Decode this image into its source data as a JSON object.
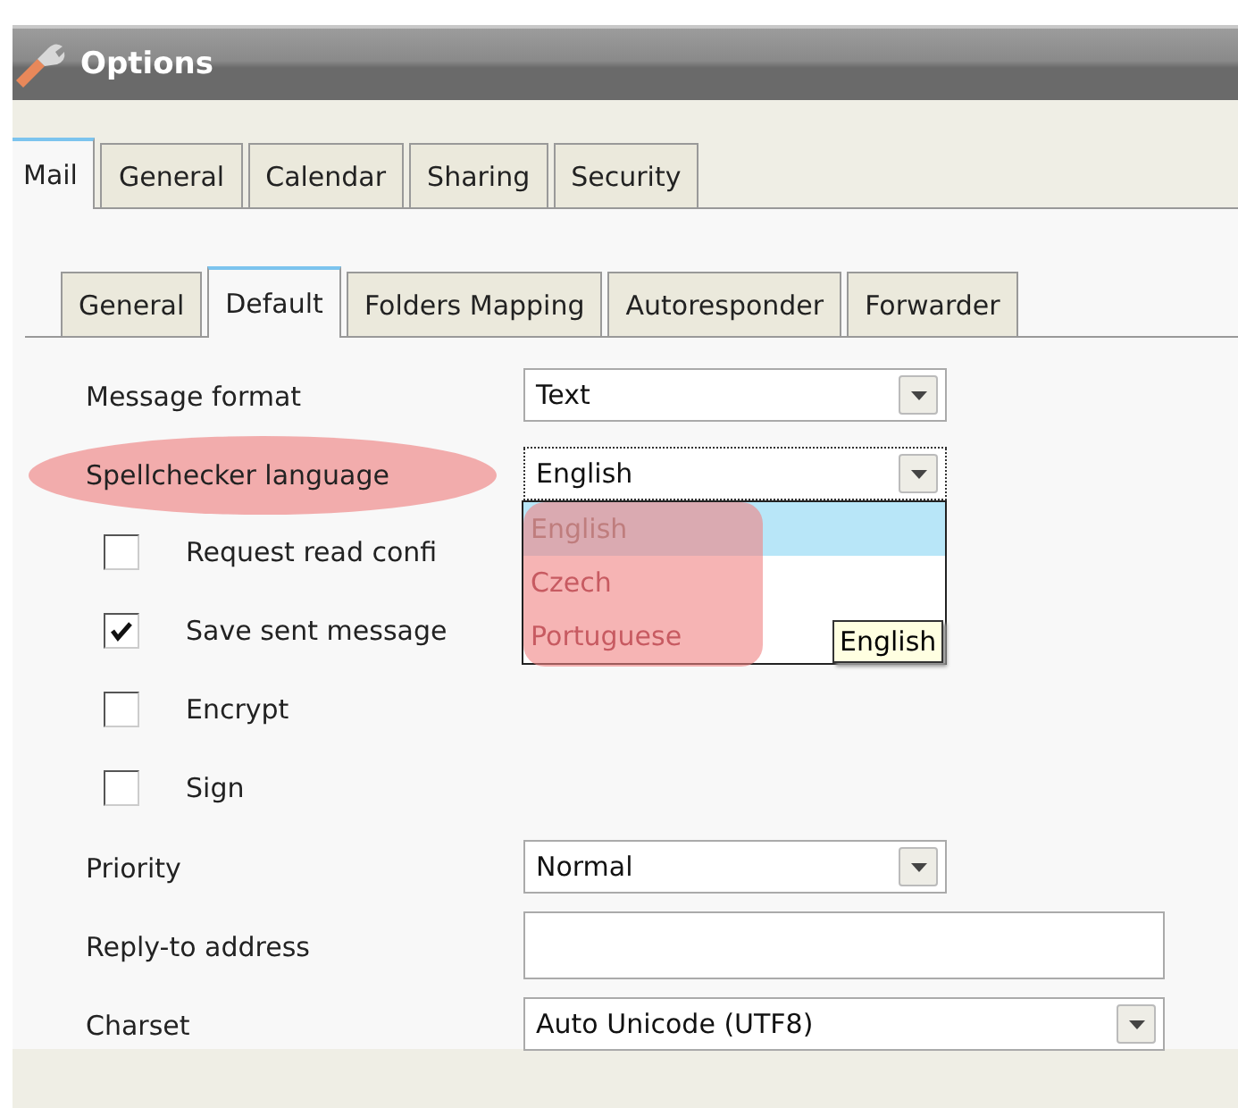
{
  "window": {
    "title": "Options"
  },
  "tabs": [
    {
      "label": "Mail",
      "selected": true
    },
    {
      "label": "General",
      "selected": false
    },
    {
      "label": "Calendar",
      "selected": false
    },
    {
      "label": "Sharing",
      "selected": false
    },
    {
      "label": "Security",
      "selected": false
    }
  ],
  "subtabs": [
    {
      "label": "General",
      "selected": false
    },
    {
      "label": "Default",
      "selected": true
    },
    {
      "label": "Folders Mapping",
      "selected": false
    },
    {
      "label": "Autoresponder",
      "selected": false
    },
    {
      "label": "Forwarder",
      "selected": false
    }
  ],
  "fields": [
    {
      "kind": "select",
      "label": "Message format",
      "value": "Text",
      "wide": false
    },
    {
      "kind": "select",
      "label": "Spellchecker language",
      "value": "English",
      "wide": false,
      "highlighted": true,
      "open": true,
      "options": [
        {
          "label": "English",
          "selected": true
        },
        {
          "label": "Czech",
          "selected": false
        },
        {
          "label": "Portuguese",
          "selected": false
        }
      ],
      "tooltip": "English"
    },
    {
      "kind": "checkbox",
      "label": "Request read confi",
      "checked": false
    },
    {
      "kind": "checkbox",
      "label": "Save sent message",
      "checked": true
    },
    {
      "kind": "checkbox",
      "label": "Encrypt",
      "checked": false
    },
    {
      "kind": "checkbox",
      "label": "Sign",
      "checked": false
    },
    {
      "kind": "select",
      "label": "Priority",
      "value": "Normal",
      "wide": false
    },
    {
      "kind": "text",
      "label": "Reply-to address"
    },
    {
      "kind": "select",
      "label": "Charset",
      "value": "Auto Unicode (UTF8)",
      "wide": true
    }
  ]
}
